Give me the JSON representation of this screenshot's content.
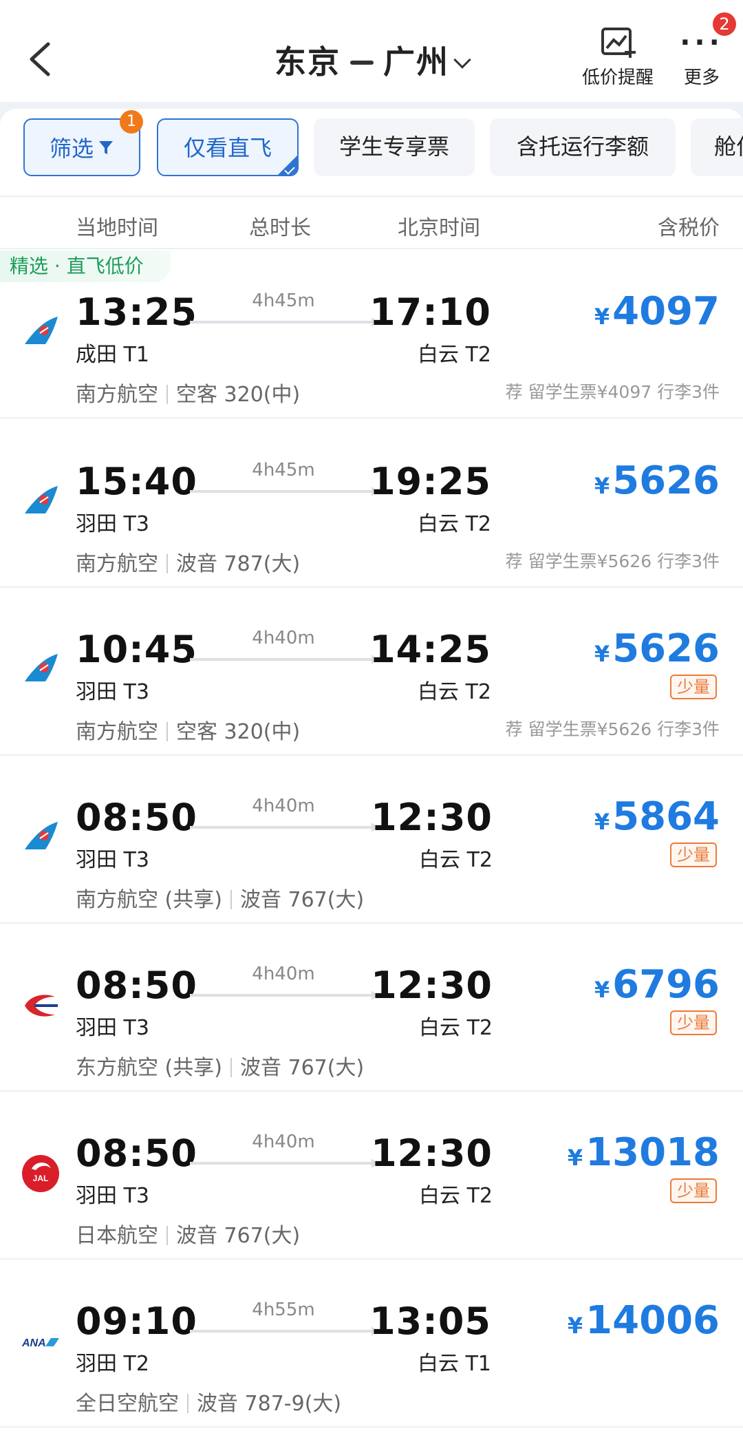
{
  "header": {
    "origin": "东京",
    "destination": "广州",
    "alert_label": "低价提醒",
    "more_label": "更多",
    "more_badge": "2"
  },
  "filters": [
    {
      "label": "筛选",
      "badge": "1",
      "active": true
    },
    {
      "label": "仅看直飞",
      "active": true
    },
    {
      "label": "学生专享票",
      "active": false
    },
    {
      "label": "含托运行李额",
      "active": false
    },
    {
      "label": "舱位",
      "active": false
    }
  ],
  "columns": {
    "local_time": "当地时间",
    "duration": "总时长",
    "beijing_time": "北京时间",
    "price": "含税价"
  },
  "tag": "精选 · 直飞低价",
  "flights": [
    {
      "dep_time": "13:25",
      "dep_airport": "成田 T1",
      "duration": "4h45m",
      "arr_time": "17:10",
      "arr_airport": "白云 T2",
      "price": "4097",
      "currency": "¥",
      "airline": "南方航空",
      "aircraft": "空客 320(中)",
      "rec": "荐 留学生票¥4097 行李3件",
      "few": "",
      "logo": "china-southern"
    },
    {
      "dep_time": "15:40",
      "dep_airport": "羽田 T3",
      "duration": "4h45m",
      "arr_time": "19:25",
      "arr_airport": "白云 T2",
      "price": "5626",
      "currency": "¥",
      "airline": "南方航空",
      "aircraft": "波音 787(大)",
      "rec": "荐 留学生票¥5626 行李3件",
      "few": "",
      "logo": "china-southern"
    },
    {
      "dep_time": "10:45",
      "dep_airport": "羽田 T3",
      "duration": "4h40m",
      "arr_time": "14:25",
      "arr_airport": "白云 T2",
      "price": "5626",
      "currency": "¥",
      "airline": "南方航空",
      "aircraft": "空客 320(中)",
      "rec": "荐 留学生票¥5626 行李3件",
      "few": "少量",
      "logo": "china-southern"
    },
    {
      "dep_time": "08:50",
      "dep_airport": "羽田 T3",
      "duration": "4h40m",
      "arr_time": "12:30",
      "arr_airport": "白云 T2",
      "price": "5864",
      "currency": "¥",
      "airline": "南方航空 (共享)",
      "aircraft": "波音 767(大)",
      "rec": "",
      "few": "少量",
      "logo": "china-southern"
    },
    {
      "dep_time": "08:50",
      "dep_airport": "羽田 T3",
      "duration": "4h40m",
      "arr_time": "12:30",
      "arr_airport": "白云 T2",
      "price": "6796",
      "currency": "¥",
      "airline": "东方航空 (共享)",
      "aircraft": "波音 767(大)",
      "rec": "",
      "few": "少量",
      "logo": "china-eastern"
    },
    {
      "dep_time": "08:50",
      "dep_airport": "羽田 T3",
      "duration": "4h40m",
      "arr_time": "12:30",
      "arr_airport": "白云 T2",
      "price": "13018",
      "currency": "¥",
      "airline": "日本航空",
      "aircraft": "波音 767(大)",
      "rec": "",
      "few": "少量",
      "logo": "jal",
      "logo_text": "JAL"
    },
    {
      "dep_time": "09:10",
      "dep_airport": "羽田 T2",
      "duration": "4h55m",
      "arr_time": "13:05",
      "arr_airport": "白云 T1",
      "price": "14006",
      "currency": "¥",
      "airline": "全日空航空",
      "aircraft": "波音 787-9(大)",
      "rec": "",
      "few": "",
      "logo": "ana",
      "logo_text": "ANA"
    }
  ]
}
